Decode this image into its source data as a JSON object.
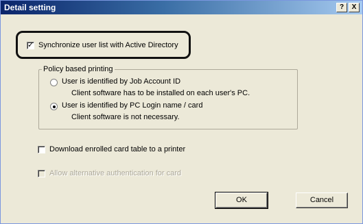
{
  "window": {
    "title": "Detail setting",
    "help_button": "?",
    "close_button": "X"
  },
  "sync_ad": {
    "label": "Synchronize user list with Active Directory",
    "checked": true
  },
  "policy_group": {
    "title": "Policy based printing",
    "options": [
      {
        "label": "User is identified by Job Account ID",
        "description": "Client software has to be installed on each user's PC.",
        "selected": false
      },
      {
        "label": "User is identified by PC Login name / card",
        "description": "Client software is not necessary.",
        "selected": true
      }
    ]
  },
  "download_card": {
    "label": "Download enrolled card table to a printer",
    "checked": false
  },
  "alt_auth": {
    "label": "Allow alternative authentication for card",
    "checked": false,
    "enabled": false
  },
  "buttons": {
    "ok": "OK",
    "cancel": "Cancel"
  }
}
